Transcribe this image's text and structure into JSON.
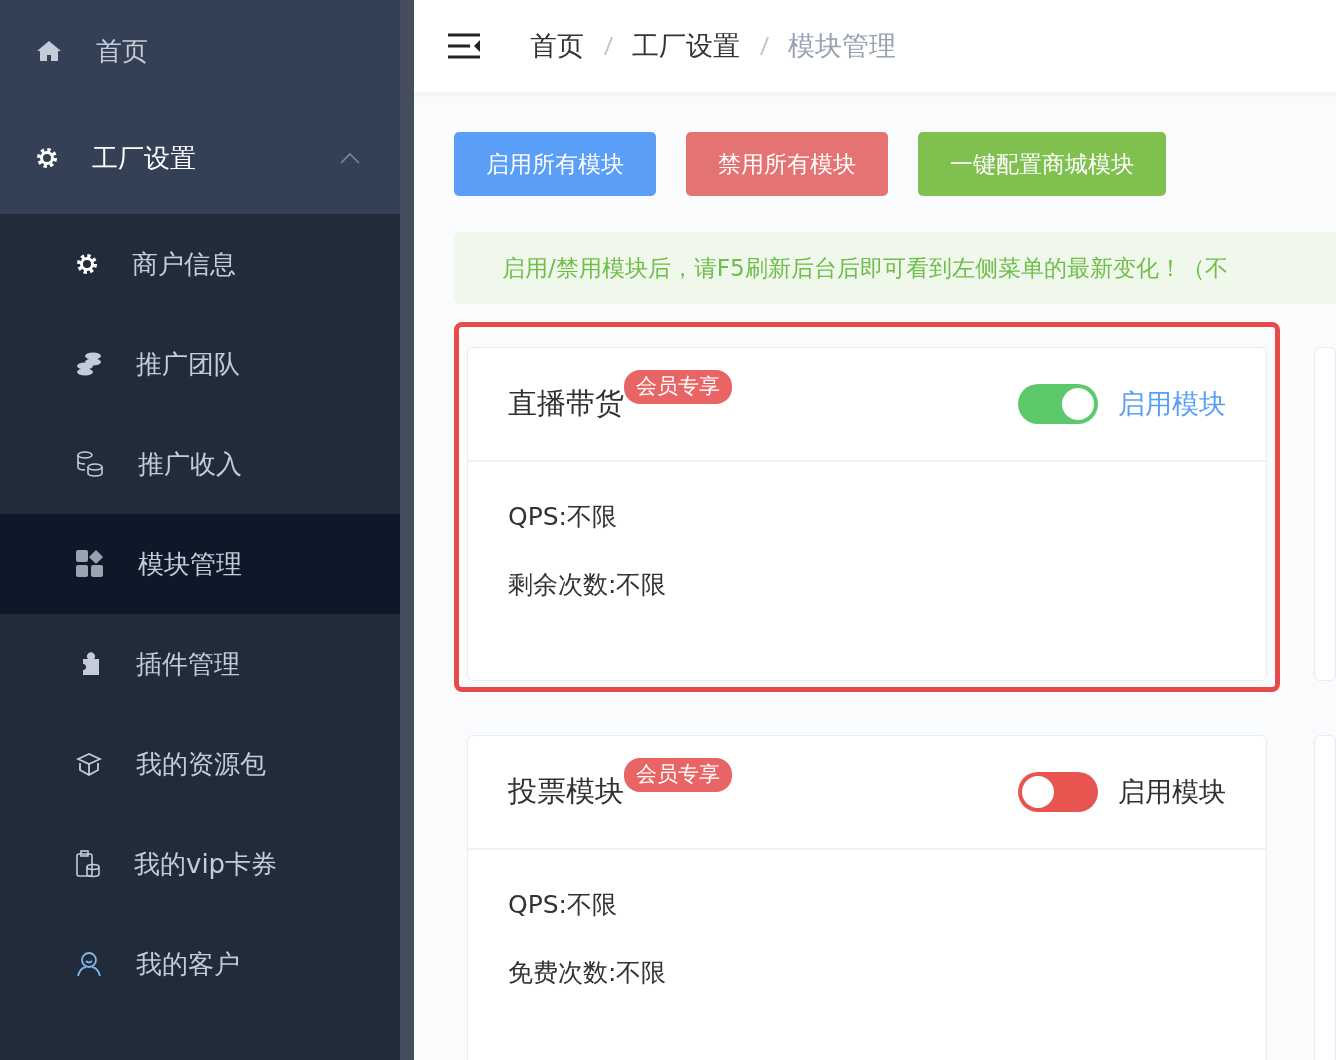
{
  "sidebar": {
    "items": [
      {
        "label": "首页"
      },
      {
        "label": "工厂设置",
        "expanded": true,
        "children": [
          {
            "label": "商户信息",
            "selected": false
          },
          {
            "label": "推广团队",
            "selected": false
          },
          {
            "label": "推广收入",
            "selected": false
          },
          {
            "label": "模块管理",
            "selected": true
          },
          {
            "label": "插件管理",
            "selected": false
          },
          {
            "label": "我的资源包",
            "selected": false
          },
          {
            "label": "我的vip卡券",
            "selected": false
          },
          {
            "label": "我的客户",
            "selected": false
          }
        ]
      }
    ]
  },
  "breadcrumb": [
    "首页",
    "工厂设置",
    "模块管理"
  ],
  "buttons": [
    {
      "label": "启用所有模块",
      "color": "#5a9ef8"
    },
    {
      "label": "禁用所有模块",
      "color": "#e57373"
    },
    {
      "label": "一键配置商城模块",
      "color": "#80c04f"
    }
  ],
  "notice": "启用/禁用模块后，请F5刷新后台后即可看到左侧菜单的最新变化！（不",
  "modules": [
    {
      "title": "直播带货",
      "badge": "会员专享",
      "on": true,
      "toggle_label": "启用模块",
      "highlighted": true,
      "lines": [
        "QPS:不限",
        "剩余次数:不限"
      ]
    },
    {
      "title": "投票模块",
      "badge": "会员专享",
      "on": false,
      "toggle_label": "启用模块",
      "highlighted": false,
      "lines": [
        "QPS:不限",
        "免费次数:不限"
      ]
    }
  ]
}
